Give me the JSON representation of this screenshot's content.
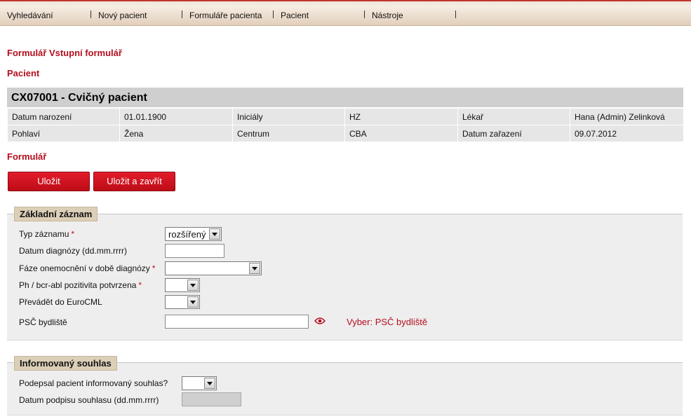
{
  "menu": [
    "Vyhledávání",
    "Nový pacient",
    "Formuláře pacienta",
    "Pacient",
    "Nástroje"
  ],
  "page": {
    "form_title": "Formulář Vstupní formulář",
    "patient_heading": "Pacient",
    "form_heading": "Formulář"
  },
  "patient": {
    "title": "CX07001 - Cvičný pacient",
    "rows": [
      [
        "Datum narození",
        "01.01.1900",
        "Iniciály",
        "HZ",
        "Lékař",
        "Hana (Admin) Zelinková"
      ],
      [
        "Pohlaví",
        "Žena",
        "Centrum",
        "CBA",
        "Datum zařazení",
        "09.07.2012"
      ]
    ]
  },
  "buttons": {
    "save": "Uložit",
    "save_close": "Uložit a zavřít"
  },
  "basic_record": {
    "legend": "Základní záznam",
    "record_type_label": "Typ záznamu",
    "record_type_value": "rozšířený",
    "diagnosis_date_label": "Datum diagnózy (dd.mm.rrrr)",
    "disease_phase_label": "Fáze onemocnění v době diagnózy",
    "ph_label": "Ph / bcr-abl pozitivita potvrzena",
    "eurocml_label": "Převádět do EuroCML",
    "psc_label": "PSČ bydliště",
    "psc_pick": "Vyber: PSČ bydliště",
    "required_mark": "*"
  },
  "consent": {
    "legend": "Informovaný souhlas",
    "signed_label": "Podepsal pacient informovaný souhlas?",
    "sign_date_label": "Datum podpisu souhlasu (dd.mm.rrrr)"
  },
  "colors": {
    "accent": "#b40f1e",
    "button": "#d0121f",
    "legend_bg": "#dccfb8",
    "panel_bg": "#eeeeee"
  }
}
